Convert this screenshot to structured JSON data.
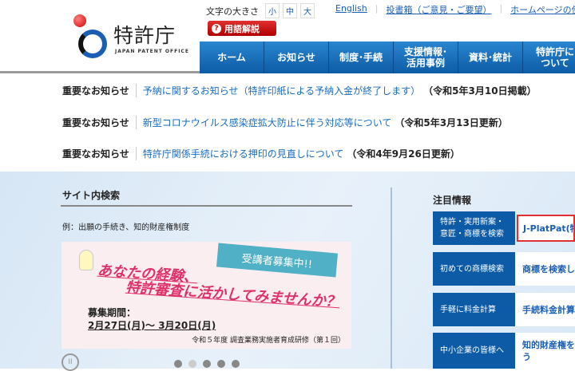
{
  "header": {
    "logo_name": "特許庁",
    "logo_sub": "JAPAN PATENT OFFICE",
    "font_size_label": "文字の大きさ",
    "font_sizes": [
      "小",
      "中",
      "大"
    ],
    "top_links": [
      "English",
      "投書箱（ご意見・ご要望）",
      "ホームページの使い方"
    ],
    "glossary_label": "用語解説"
  },
  "nav": [
    "ホーム",
    "お知らせ",
    "制度･手続",
    "支援情報･\n活用事例",
    "資料･統計",
    "特許庁に\nついて"
  ],
  "notices": [
    {
      "tag": "重要なお知らせ",
      "link": "予納に関するお知らせ（特許印紙による予納入金が終了します）",
      "date": "（令和5年3月10日掲載）"
    },
    {
      "tag": "重要なお知らせ",
      "link": "新型コロナウイルス感染症拡大防止に伴う対応等について",
      "date": "（令和5年3月13日更新）"
    },
    {
      "tag": "重要なお知らせ",
      "link": "特許庁関係手続における押印の見直しについて",
      "date": "（令和4年9月26日更新）"
    }
  ],
  "search": {
    "title": "サイト内検索",
    "example": "例：出願の手続き、知的財産権制度"
  },
  "banner": {
    "ribbon": "受講者募集中!!",
    "headline1": "あなたの経験、",
    "headline2": "特許審査に活かしてみませんか？",
    "period_label": "募集期間：",
    "period": "2月27日(月)～ 3月20日(月)",
    "course": "令和５年度 調査業務実施者育成研修（第１回）"
  },
  "carousel": {
    "pause": "II",
    "active_dot": 2,
    "dot_count": 5
  },
  "featured": {
    "title": "注目情報",
    "rows": [
      {
        "category": "特許・実用新案・\n意匠・商標を検索",
        "link": "J-PlatPat(特"
      },
      {
        "category": "初めての商標検索",
        "link": "商標を検索し"
      },
      {
        "category": "手軽に料金計算",
        "link": "手続料金計算"
      },
      {
        "category": "中小企業の皆様へ",
        "link": "知的財産権を\nう"
      }
    ]
  }
}
